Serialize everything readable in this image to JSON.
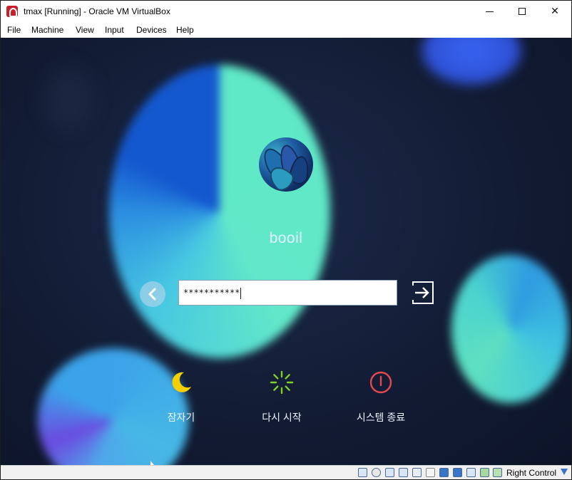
{
  "window": {
    "title": "tmax [Running] - Oracle VM VirtualBox",
    "controls": {
      "minimize": "",
      "maximize": "",
      "close": "✕"
    }
  },
  "menu": {
    "items": [
      "File",
      "Machine",
      "View",
      "Input",
      "Devices",
      "Help"
    ]
  },
  "login": {
    "username": "booil",
    "password_mask": "***********"
  },
  "actions": [
    {
      "label": "잠자기",
      "icon": "moon-icon",
      "color": "#f0d000"
    },
    {
      "label": "다시 시작",
      "icon": "restart-icon",
      "color": "#7ed321"
    },
    {
      "label": "시스템 종료",
      "icon": "power-icon",
      "color": "#e8474e"
    }
  ],
  "statusbar": {
    "host_key": "Right Control",
    "icons": [
      "hard-disk-icon",
      "optical-drive-icon",
      "audio-icon",
      "network-icon",
      "usb-icon",
      "shared-folders-icon",
      "display-icon",
      "video-capture-icon",
      "cpu-icon",
      "mouse-integration-icon",
      "keyboard-icon"
    ]
  },
  "colors": {
    "accent_blue": "#3a74c8",
    "background_dark": "#121b33"
  }
}
